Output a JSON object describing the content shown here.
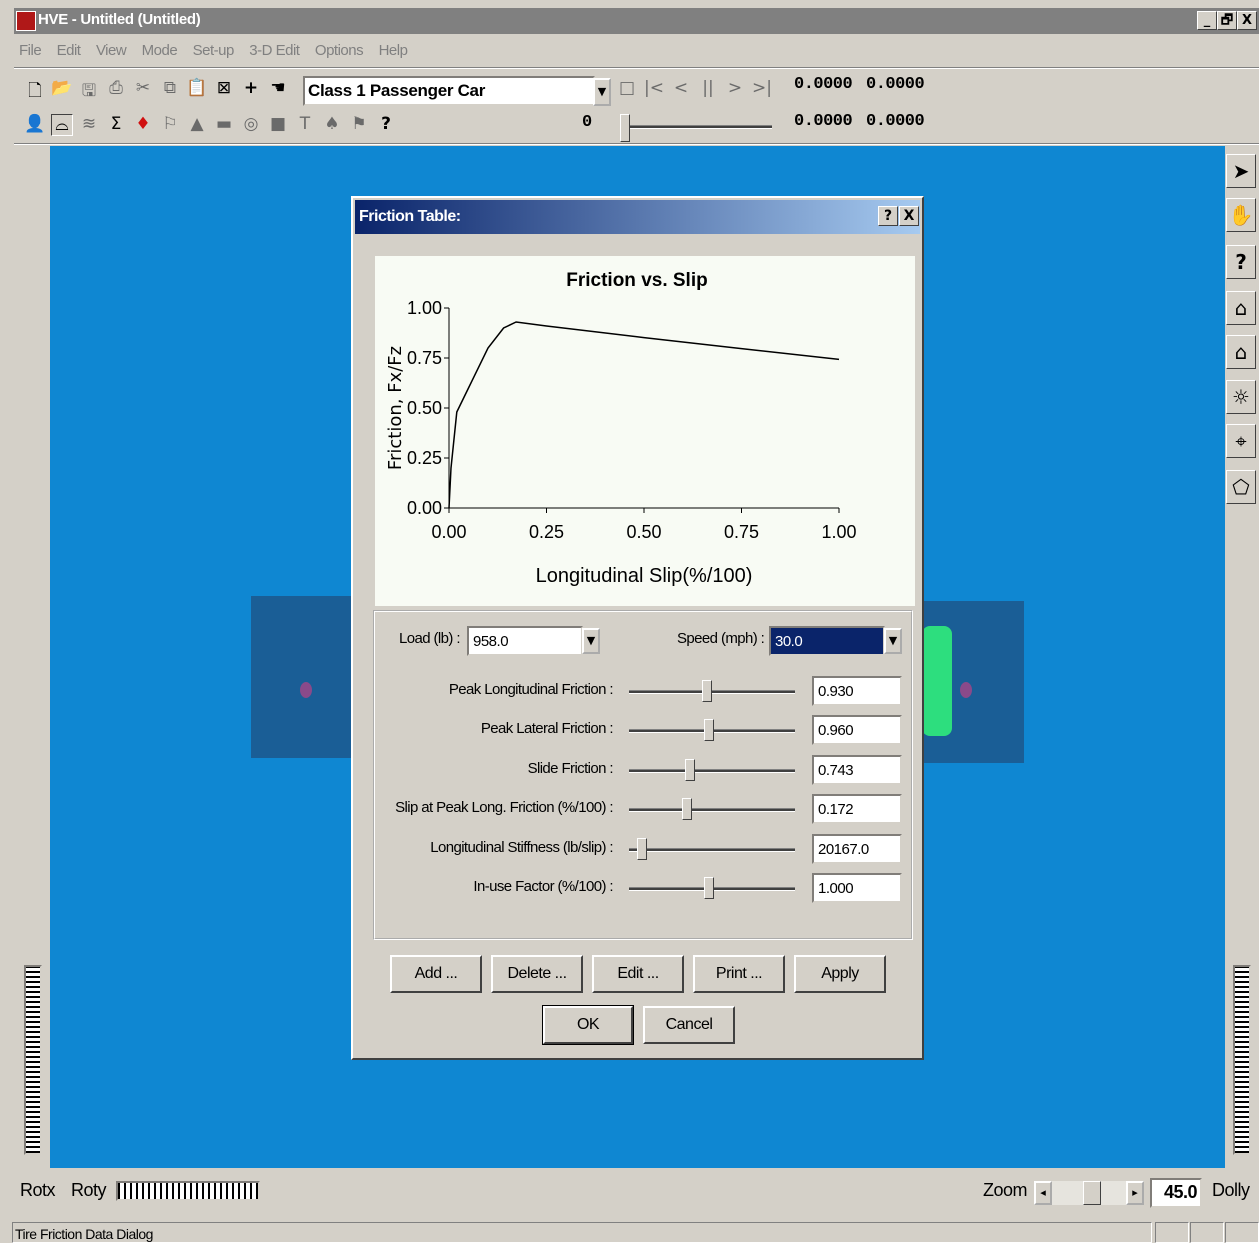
{
  "window": {
    "title": "HVE -  Untitled (Untitled)",
    "min": "_",
    "max": "🗗",
    "close": "X"
  },
  "menu": [
    "File",
    "Edit",
    "View",
    "Mode",
    "Set-up",
    "3-D Edit",
    "Options",
    "Help"
  ],
  "toolbar": {
    "vehicle_select": "Class 1 Passenger Car",
    "frame_value": "0",
    "readouts": [
      "0.0000",
      "0.0000",
      "0.0000",
      "0.0000"
    ]
  },
  "dialog": {
    "title": "Friction Table:",
    "help": "?",
    "close": "X",
    "load_label": "Load (lb) :",
    "load_value": "958.0",
    "speed_label": "Speed (mph) :",
    "speed_value": "30.0",
    "params": [
      {
        "label": "Peak Longitudinal Friction :",
        "value": "0.930",
        "position": 0.47
      },
      {
        "label": "Peak Lateral Friction :",
        "value": "0.960",
        "position": 0.48
      },
      {
        "label": "Slide Friction :",
        "value": "0.743",
        "position": 0.37
      },
      {
        "label": "Slip at  Peak Long. Friction (%/100) :",
        "value": "0.172",
        "position": 0.35
      },
      {
        "label": "Longitudinal Stiffness (lb/slip) :",
        "value": "20167.0",
        "position": 0.08
      },
      {
        "label": "In-use Factor (%/100) :",
        "value": "1.000",
        "position": 0.48
      }
    ],
    "buttons": {
      "add": "Add ...",
      "delete": "Delete ...",
      "edit": "Edit ...",
      "print": "Print ...",
      "apply": "Apply",
      "ok": "OK",
      "cancel": "Cancel"
    }
  },
  "chart_data": {
    "type": "line",
    "title": "Friction vs. Slip",
    "xlabel": "Longitudinal Slip(%/100)",
    "ylabel": "Friction, Fx/Fz",
    "xlim": [
      0,
      1
    ],
    "ylim": [
      0,
      1
    ],
    "xticks": [
      "0.00",
      "0.25",
      "0.50",
      "0.75",
      "1.00"
    ],
    "yticks": [
      "0.00",
      "0.25",
      "0.50",
      "0.75",
      "1.00"
    ],
    "series": [
      {
        "x": [
          0,
          0.005,
          0.02,
          0.05,
          0.1,
          0.14,
          0.172,
          0.25,
          0.5,
          0.75,
          1.0
        ],
        "y": [
          0,
          0.2,
          0.48,
          0.6,
          0.8,
          0.9,
          0.93,
          0.91,
          0.852,
          0.797,
          0.743
        ]
      }
    ]
  },
  "bottom": {
    "rotx": "Rotx",
    "roty": "Roty",
    "zoom": "Zoom",
    "zoom_value": "45.0",
    "dolly": "Dolly"
  },
  "status": "Tire Friction Data Dialog"
}
